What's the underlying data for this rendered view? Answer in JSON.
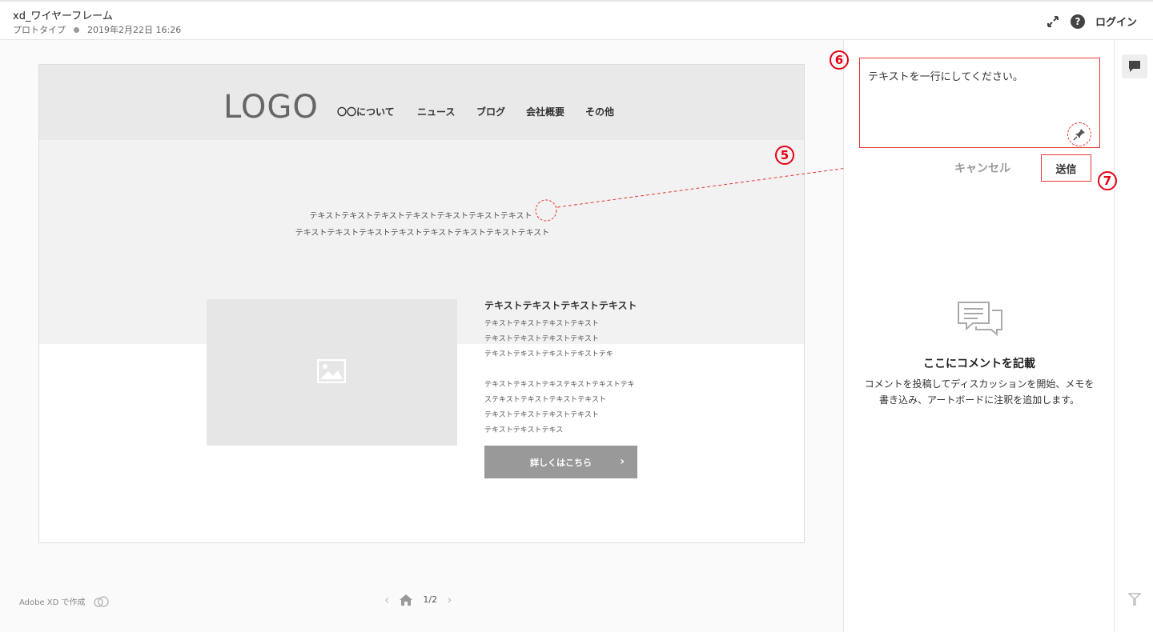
{
  "header": {
    "doc_title": "xd_ワイヤーフレーム",
    "doc_type": "プロトタイプ",
    "doc_date": "2019年2月22日 16:26",
    "login_label": "ログイン",
    "help_glyph": "?"
  },
  "artboard": {
    "logo": "LOGO",
    "nav": [
      "〇〇について",
      "ニュース",
      "ブログ",
      "会社概要",
      "その他"
    ],
    "hero_lines": [
      "テキストテキストテキストテキストテキストテキストテキスト",
      "テキストテキストテキストテキストテキストテキストテキストテキスト"
    ],
    "section": {
      "heading": "テキストテキストテキストテキスト",
      "lines": [
        "テキストテキストテキストテキスト",
        "テキストテキストテキストテキスト",
        "テキストテキストテキストテキストテキ",
        "",
        "テキストテキストテキステキストテキストテキ",
        "ステキストテキストテキストテキスト",
        "テキストテキストテキストテキスト",
        "テキストテキストテキス"
      ],
      "button_label": "詳しくはこちら",
      "button_chevron": "›"
    }
  },
  "footer": {
    "made_with": "Adobe XD で作成",
    "page_indicator": "1/2",
    "prev_glyph": "‹",
    "next_glyph": "›"
  },
  "comment_panel": {
    "comment_text": "テキストを一行にしてください。",
    "cancel_label": "キャンセル",
    "send_label": "送信",
    "empty_title": "ここにコメントを記載",
    "empty_body": "コメントを投稿してディスカッションを開始、メモを書き込み、アートボードに注釈を追加します。"
  },
  "callouts": {
    "c5": "5",
    "c6": "6",
    "c7": "7"
  },
  "colors": {
    "accent_red": "#e53935",
    "button_gray": "#999999"
  }
}
